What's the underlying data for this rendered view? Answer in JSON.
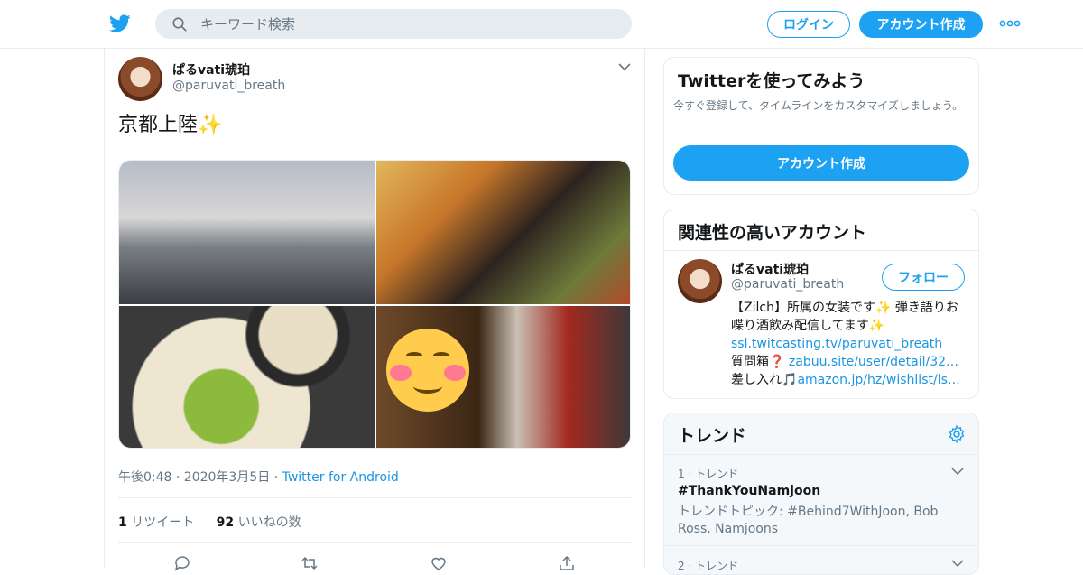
{
  "header": {
    "search_placeholder": "キーワード検索",
    "login_label": "ログイン",
    "signup_label": "アカウント作成",
    "brand_color": "#1da1f2"
  },
  "tweet": {
    "author_name": "ぱるvati琥珀",
    "author_handle": "@paruvati_breath",
    "text": "京都上陸✨",
    "timestamp": "午後0:48 · 2020年3月5日",
    "source_sep": " · ",
    "source": "Twitter for Android",
    "retweet_count": "1",
    "retweet_label": "リツイート",
    "like_count": "92",
    "like_label": "いいねの数",
    "media": [
      {
        "alt": "street"
      },
      {
        "alt": "beer-and-gyoza"
      },
      {
        "alt": "ramen"
      },
      {
        "alt": "drinks-with-smiley"
      }
    ]
  },
  "sidebar": {
    "signup_box": {
      "title": "Twitterを使ってみよう",
      "desc": "今すぐ登録して、タイムラインをカスタマイズしましょう。",
      "button": "アカウント作成"
    },
    "related": {
      "title": "関連性の高いアカウント",
      "name": "ぱるvati琥珀",
      "handle": "@paruvati_breath",
      "follow": "フォロー",
      "bio_1": "【Zilch】所属の女装です✨ 弾き語りお喋り酒飲み配信してます✨ ",
      "link_1": "ssl.twitcasting.tv/paruvati_breath",
      "bio_2": "　質問箱❓ ",
      "link_2": "zabuu.site/user/detail/32…",
      "bio_3": " 差し入れ🎵",
      "link_3": "amazon.jp/hz/wishlist/ls…"
    },
    "trends": {
      "title": "トレンド",
      "items": [
        {
          "rank": "1 · トレンド",
          "name": "#ThankYouNamjoon",
          "sub": "トレンドトピック: #Behind7WithJoon, Bob Ross, Namjoons"
        },
        {
          "rank": "2 · トレンド",
          "name": "",
          "sub": ""
        }
      ]
    }
  }
}
